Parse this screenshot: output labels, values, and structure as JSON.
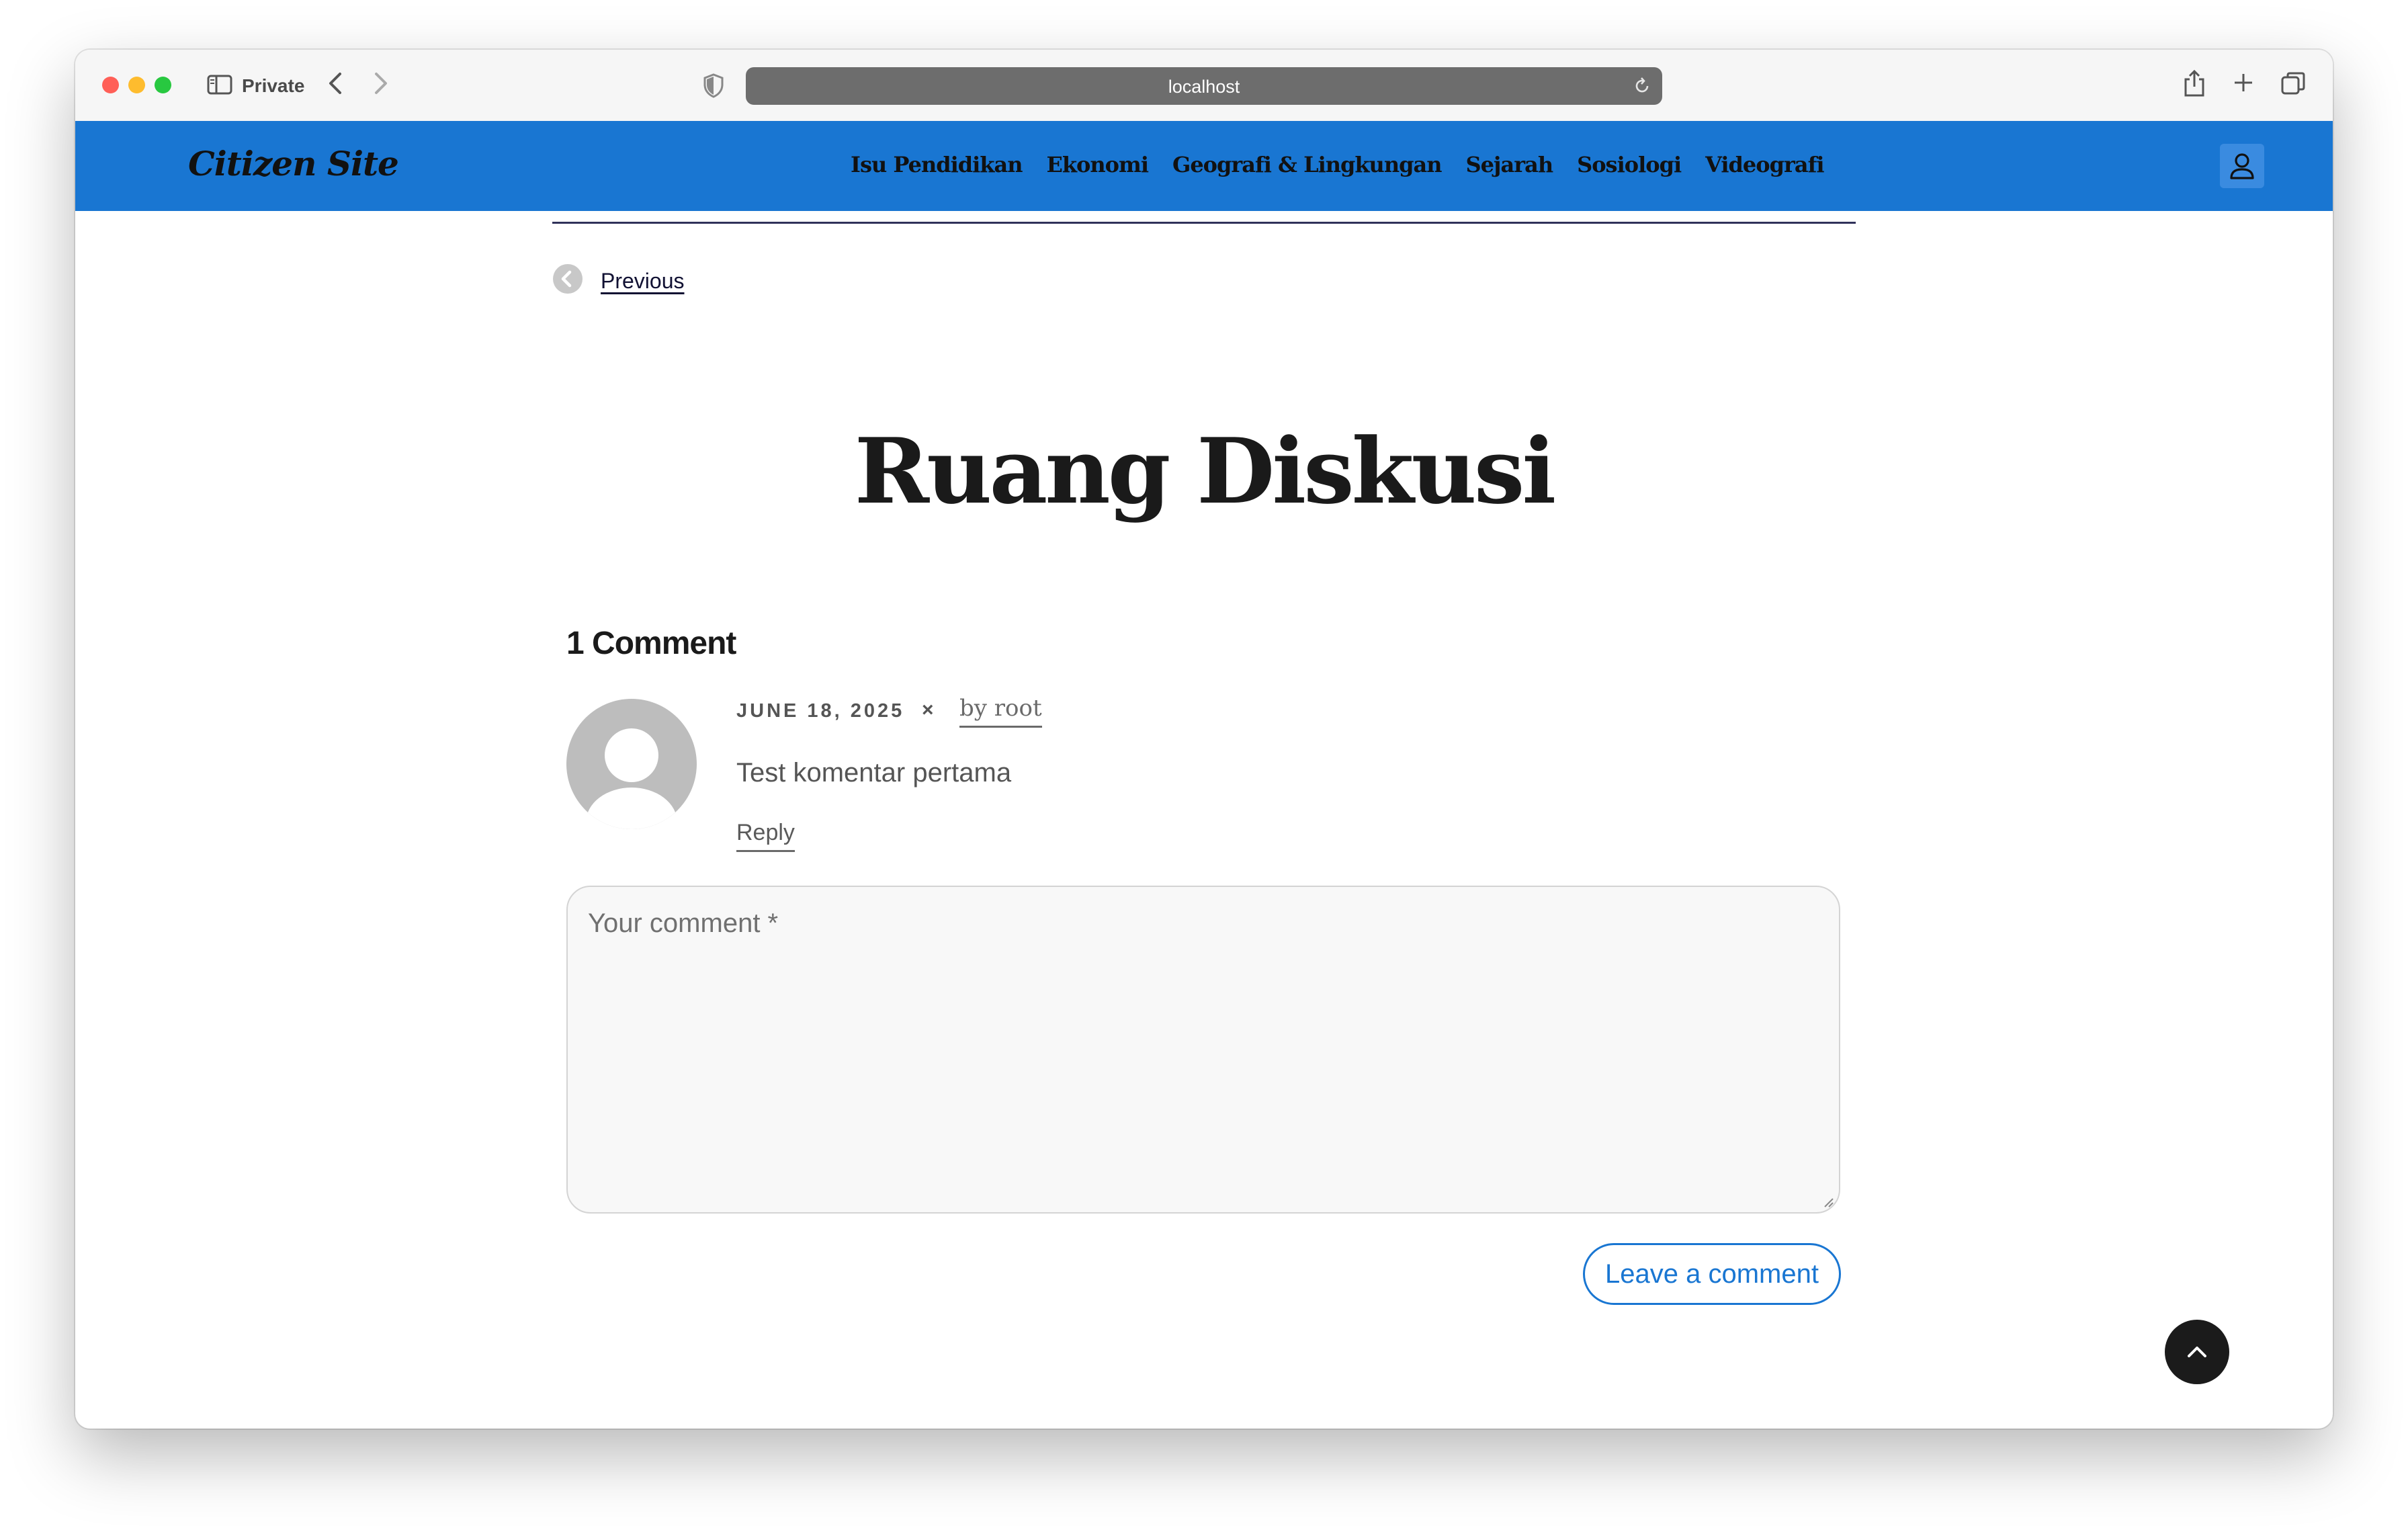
{
  "browser": {
    "private_label": "Private",
    "url": "localhost"
  },
  "site": {
    "logo": "Citizen Site",
    "menu": [
      {
        "label": "Isu Pendidikan"
      },
      {
        "label": "Ekonomi"
      },
      {
        "label": "Geografi & Lingkungan"
      },
      {
        "label": "Sejarah"
      },
      {
        "label": "Sosiologi"
      },
      {
        "label": "Videografi"
      }
    ],
    "accent_color": "#1976d2"
  },
  "post": {
    "previous_label": "Previous",
    "title": "Ruang Diskusi"
  },
  "comments": {
    "heading": "1 Comment",
    "items": [
      {
        "date": "JUNE 18, 2025",
        "separator": "×",
        "author": "by root",
        "text": "Test komentar pertama",
        "reply_label": "Reply"
      }
    ],
    "form": {
      "placeholder": "Your comment *",
      "value": "",
      "submit_label": "Leave a comment"
    }
  }
}
